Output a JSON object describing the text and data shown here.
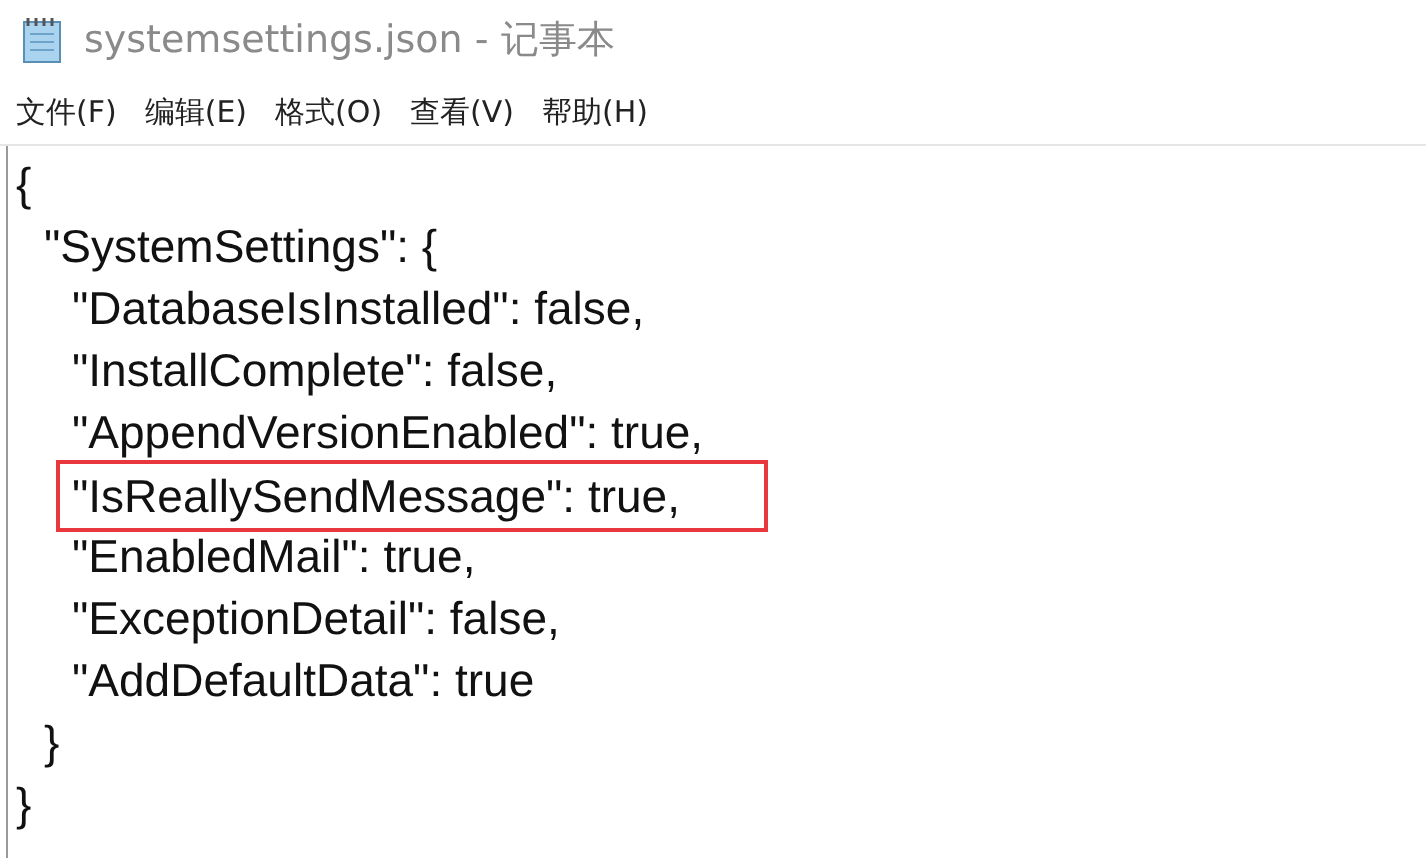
{
  "window": {
    "title": "systemsettings.json - 记事本"
  },
  "menu": [
    {
      "label": "文件(F)"
    },
    {
      "label": "编辑(E)"
    },
    {
      "label": "格式(O)"
    },
    {
      "label": "查看(V)"
    },
    {
      "label": "帮助(H)"
    }
  ],
  "editor": {
    "lines": [
      {
        "text": "{",
        "highlighted": false
      },
      {
        "text": "  \"SystemSettings\": {",
        "highlighted": false
      },
      {
        "text": "    \"DatabaseIsInstalled\": false,",
        "highlighted": false
      },
      {
        "text": "    \"InstallComplete\": false,",
        "highlighted": false
      },
      {
        "text": "    \"AppendVersionEnabled\": true,",
        "highlighted": false
      },
      {
        "text": "    \"IsReallySendMessage\": true,",
        "highlighted": true
      },
      {
        "text": "    \"EnabledMail\": true,",
        "highlighted": false
      },
      {
        "text": "    \"ExceptionDetail\": false,",
        "highlighted": false
      },
      {
        "text": "    \"AddDefaultData\": true",
        "highlighted": false
      },
      {
        "text": "  }",
        "highlighted": false
      },
      {
        "text": "}",
        "highlighted": false
      }
    ]
  }
}
